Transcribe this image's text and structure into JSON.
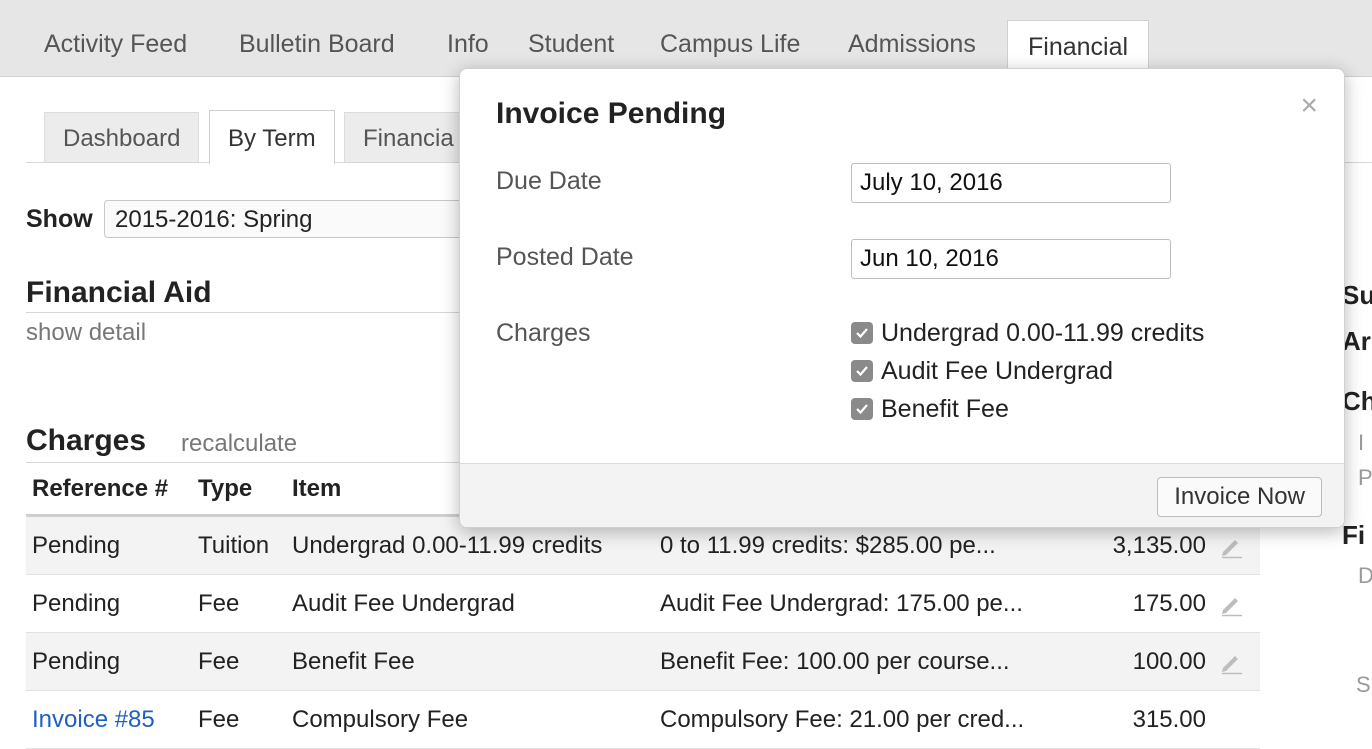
{
  "top_tabs": [
    "Activity Feed",
    "Bulletin Board",
    "Info",
    "Student",
    "Campus Life",
    "Admissions",
    "Financial"
  ],
  "active_top_tab": "Financial",
  "sub_tabs": [
    "Dashboard",
    "By Term",
    "Financia"
  ],
  "active_sub_tab": "By Term",
  "show": {
    "label": "Show",
    "value": "2015-2016: Spring"
  },
  "financial_aid": {
    "title": "Financial Aid",
    "link": "show detail"
  },
  "charges": {
    "title": "Charges",
    "link": "recalculate",
    "columns": [
      "Reference #",
      "Type",
      "Item",
      "",
      "",
      ""
    ],
    "rows": [
      {
        "ref": "Pending",
        "type": "Tuition",
        "item": "Undergrad 0.00-11.99 credits",
        "desc": "0 to 11.99 credits: $285.00 pe...",
        "amount": "3,135.00"
      },
      {
        "ref": "Pending",
        "type": "Fee",
        "item": "Audit Fee Undergrad",
        "desc": "Audit Fee Undergrad: 175.00 pe...",
        "amount": "175.00"
      },
      {
        "ref": "Pending",
        "type": "Fee",
        "item": "Benefit Fee",
        "desc": "Benefit Fee: 100.00 per course...",
        "amount": "100.00"
      },
      {
        "ref": "Invoice #85",
        "type": "Fee",
        "item": "Compulsory Fee",
        "desc": "Compulsory Fee: 21.00 per cred...",
        "amount": "315.00"
      }
    ]
  },
  "right_panel_cut": [
    "Su",
    "Ar",
    "Ch",
    "I",
    "P",
    "Fi",
    "D",
    "S"
  ],
  "modal": {
    "title": "Invoice Pending",
    "close": "×",
    "due_date_label": "Due Date",
    "due_date": "July 10, 2016",
    "posted_date_label": "Posted Date",
    "posted_date": "Jun 10, 2016",
    "charges_label": "Charges",
    "charges": [
      "Undergrad 0.00-11.99 credits",
      "Audit Fee Undergrad",
      "Benefit Fee"
    ],
    "button": "Invoice Now"
  }
}
